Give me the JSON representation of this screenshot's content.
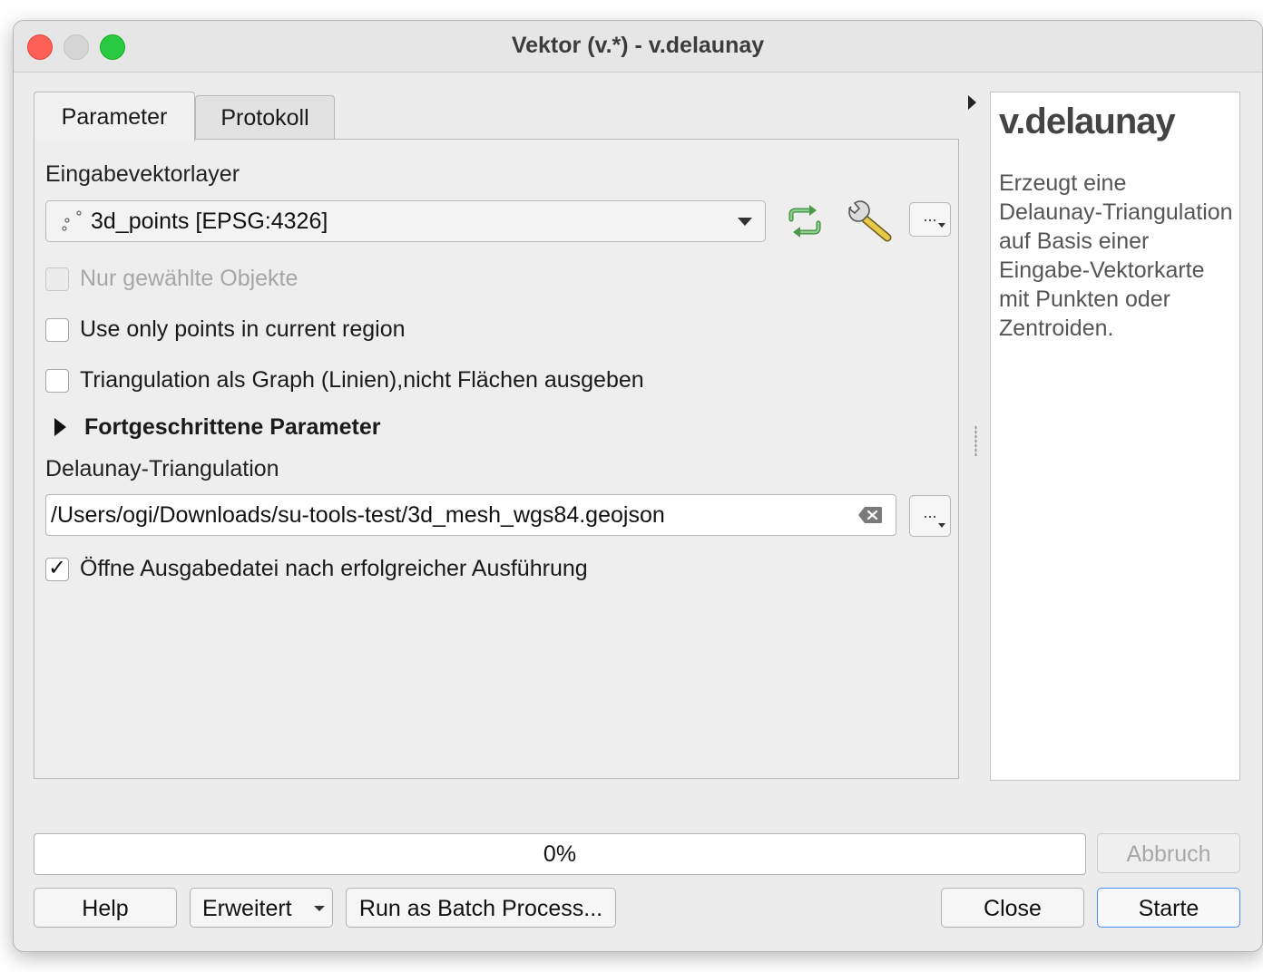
{
  "window": {
    "title": "Vektor (v.*) - v.delaunay"
  },
  "tabs": {
    "parameter": "Parameter",
    "protokoll": "Protokoll"
  },
  "input_layer": {
    "label": "Eingabevektorlayer",
    "value": "3d_points [EPSG:4326]",
    "more_button": "..."
  },
  "options": {
    "selected_only": "Nur gewählte Objekte",
    "current_region": "Use only points in current region",
    "graph_output": "Triangulation als Graph (Linien),nicht Flächen ausgeben"
  },
  "advanced": {
    "label": "Fortgeschrittene Parameter"
  },
  "output": {
    "label": "Delaunay-Triangulation",
    "path": "/Users/ogi/Downloads/su-tools-test/3d_mesh_wgs84.geojson",
    "more_button": "...",
    "open_after": "Öffne Ausgabedatei nach erfolgreicher Ausführung"
  },
  "help": {
    "title": "v.delaunay",
    "body": "Erzeugt eine Delaunay-Triangulation auf Basis einer Eingabe-Vektorkarte mit Punkten oder Zentroiden."
  },
  "progress": {
    "value": 0,
    "label": "0%"
  },
  "buttons": {
    "cancel": "Abbruch",
    "help": "Help",
    "advanced": "Erweitert",
    "batch": "Run as Batch Process...",
    "close": "Close",
    "start": "Starte"
  },
  "colors": {
    "accent": "#4a8df8",
    "close": "#fe5f57",
    "maximize": "#28c840"
  }
}
